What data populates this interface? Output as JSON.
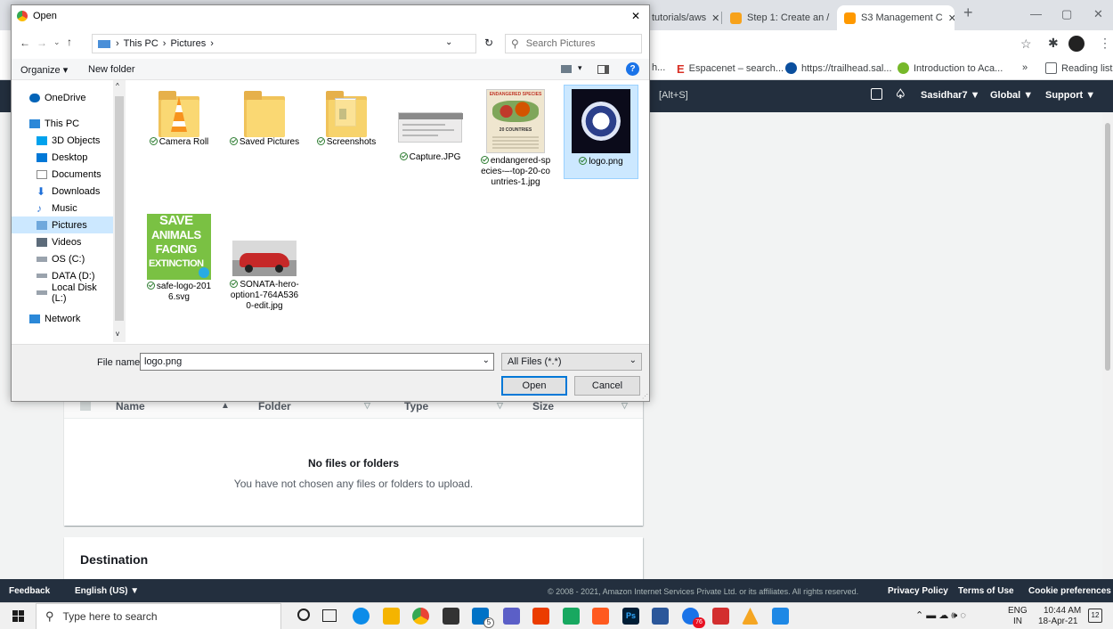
{
  "browser": {
    "tabs": [
      {
        "label": "tutorials/aws",
        "color": "#5f6368"
      },
      {
        "label": "Step 1: Create an /",
        "color": "#f7a21b"
      },
      {
        "label": "S3 Management C",
        "color": "#ff9900"
      }
    ],
    "new_tab": "+",
    "bookmarks": [
      {
        "label": "h...",
        "color": "#ffffff"
      },
      {
        "label": "Espacenet – search...",
        "color": "#d93025"
      },
      {
        "label": "https://trailhead.sal...",
        "color": "#0b4f9e"
      },
      {
        "label": "Introduction to Aca...",
        "color": "#76b82a"
      },
      {
        "label": "»",
        "color": "#ffffff"
      },
      {
        "label": "Reading list",
        "color": "#5f6368"
      }
    ]
  },
  "aws": {
    "search_hint": "[Alt+S]",
    "user": "Sasidhar7 ▼",
    "region": "Global ▼",
    "support": "Support ▼",
    "files_table": {
      "columns": [
        "Name",
        "Folder",
        "Type",
        "Size"
      ],
      "empty_title": "No files or folders",
      "empty_subtitle": "You have not chosen any files or folders to upload."
    },
    "destination_title": "Destination",
    "footer": {
      "feedback": "Feedback",
      "language": "English (US) ▼",
      "copyright": "© 2008 - 2021, Amazon Internet Services Private Ltd. or its affiliates. All rights reserved.",
      "privacy": "Privacy Policy",
      "terms": "Terms of Use",
      "cookies": "Cookie preferences"
    }
  },
  "dialog": {
    "title": "Open",
    "close": "✕",
    "breadcrumb": [
      "This PC",
      "Pictures"
    ],
    "search_placeholder": "Search Pictures",
    "organize": "Organize ▾",
    "new_folder": "New folder",
    "nav_items": [
      {
        "label": "OneDrive",
        "color": "#0364b8"
      },
      {
        "label": "This PC",
        "color": "#2b88d8"
      },
      {
        "label": "3D Objects",
        "color": "#00a2ed"
      },
      {
        "label": "Desktop",
        "color": "#0078d7"
      },
      {
        "label": "Documents",
        "color": "#8a8a8a"
      },
      {
        "label": "Downloads",
        "color": "#1e6fd9"
      },
      {
        "label": "Music",
        "color": "#3a7bd5"
      },
      {
        "label": "Pictures",
        "color": "#6fa8dc"
      },
      {
        "label": "Videos",
        "color": "#5c6b7a"
      },
      {
        "label": "OS (C:)",
        "color": "#9aa3ad"
      },
      {
        "label": "DATA (D:)",
        "color": "#9aa3ad"
      },
      {
        "label": "Local Disk (L:)",
        "color": "#9aa3ad"
      },
      {
        "label": "Network",
        "color": "#2b88d8"
      }
    ],
    "files": [
      {
        "name": "Camera Roll"
      },
      {
        "name": "Saved Pictures"
      },
      {
        "name": "Screenshots"
      },
      {
        "name": "Capture.JPG"
      },
      {
        "name": "endangered-species-–-top-20-countries-1.jpg"
      },
      {
        "name": "logo.png"
      },
      {
        "name": "safe-logo-2016.svg"
      },
      {
        "name": "SONATA-hero-option1-764A5360-edit.jpg"
      }
    ],
    "endangered_thumb_title": "ENDANGERED SPECIES",
    "endangered_thumb_sub": "20 COUNTRIES",
    "save_animals_text": [
      "SAVE",
      "ANIMALS",
      "FACING",
      "EXTINCTION"
    ],
    "file_name_label": "File name:",
    "file_name_value": "logo.png",
    "file_type": "All Files (*.*)",
    "open_button": "Open",
    "cancel_button": "Cancel"
  },
  "taskbar": {
    "search_placeholder": "Type here to search",
    "lang_top": "ENG",
    "lang_bottom": "IN",
    "time": "10:44 AM",
    "date": "18-Apr-21",
    "notification_count": "12",
    "badge_mail": "5",
    "badge_app": "76"
  }
}
